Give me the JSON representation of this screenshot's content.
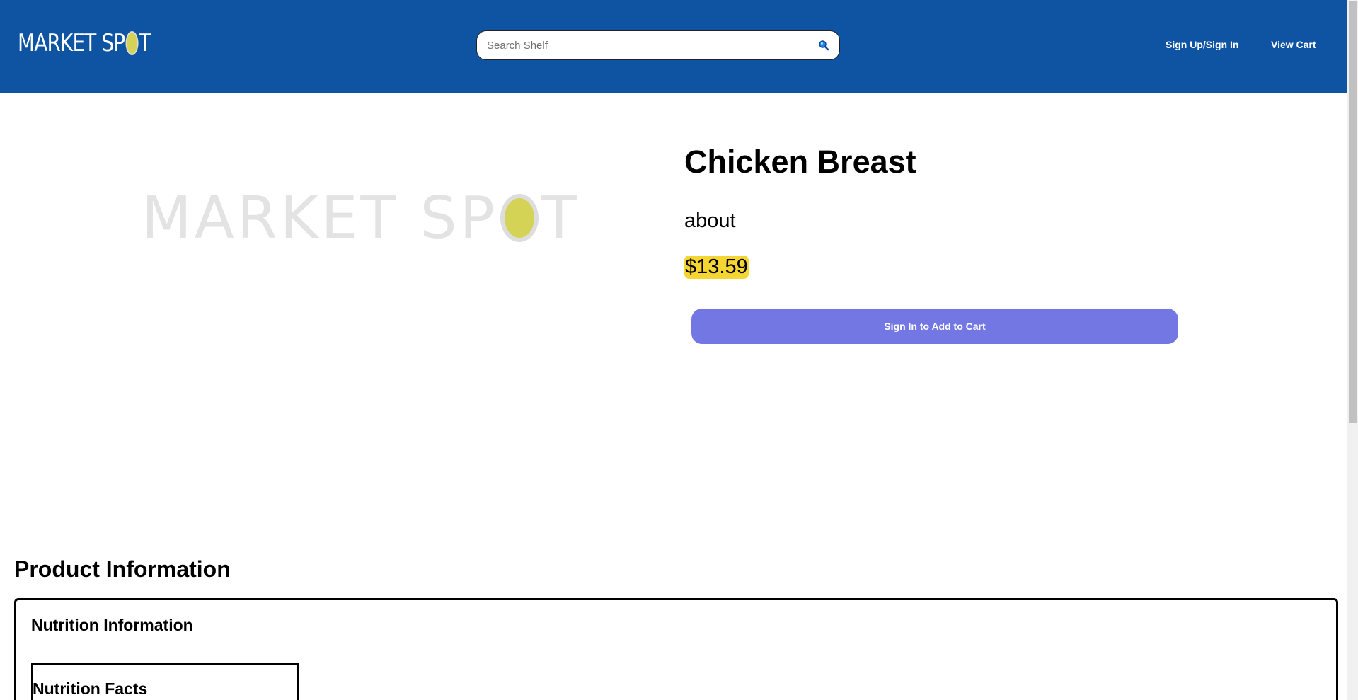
{
  "header": {
    "logo": {
      "text_before": "MARKET SP",
      "text_after": "T"
    },
    "search": {
      "placeholder": "Search Shelf",
      "value": ""
    },
    "nav": {
      "signin_label": "Sign Up/Sign In",
      "cart_label": "View Cart"
    }
  },
  "product": {
    "image_logo": {
      "text_before": "MARKET SP",
      "text_after": "T"
    },
    "title": "Chicken Breast",
    "about": "about",
    "price": "$13.59",
    "add_button_label": "Sign In to Add to Cart"
  },
  "info": {
    "heading": "Product Information",
    "nutrition_heading": "Nutrition Information",
    "facts_title": "Nutrition Facts"
  },
  "colors": {
    "header_bg": "#0f53a3",
    "button_bg": "#7377e3",
    "price_highlight": "#f5d532",
    "logo_accent": "#d4d356"
  },
  "icons": {
    "search": "search-icon"
  }
}
